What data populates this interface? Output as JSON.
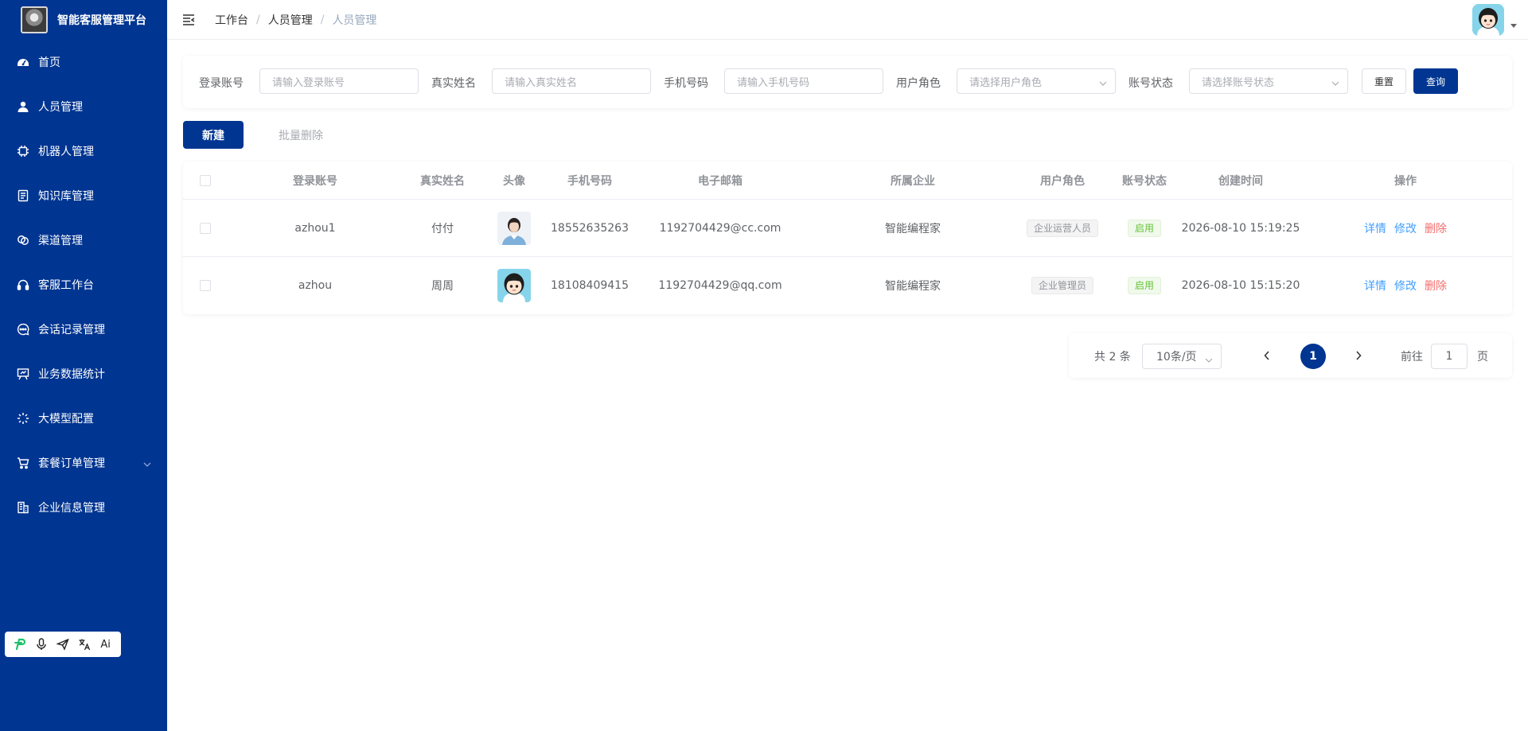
{
  "app": {
    "title": "智能客服管理平台"
  },
  "sidebar": {
    "items": [
      {
        "label": "首页",
        "icon": "dashboard-icon"
      },
      {
        "label": "人员管理",
        "icon": "user-icon"
      },
      {
        "label": "机器人管理",
        "icon": "chip-icon"
      },
      {
        "label": "知识库管理",
        "icon": "document-icon"
      },
      {
        "label": "渠道管理",
        "icon": "link-icon"
      },
      {
        "label": "客服工作台",
        "icon": "headset-icon"
      },
      {
        "label": "会话记录管理",
        "icon": "chat-icon"
      },
      {
        "label": "业务数据统计",
        "icon": "presentation-icon"
      },
      {
        "label": "大模型配置",
        "icon": "sparkle-icon"
      },
      {
        "label": "套餐订单管理",
        "icon": "cart-icon",
        "has_submenu": true
      },
      {
        "label": "企业信息管理",
        "icon": "building-icon"
      }
    ],
    "toolbar": {
      "ai_label": "Ai"
    }
  },
  "header": {
    "breadcrumb": [
      "工作台",
      "人员管理",
      "人员管理"
    ]
  },
  "search": {
    "account_label": "登录账号",
    "account_placeholder": "请输入登录账号",
    "name_label": "真实姓名",
    "name_placeholder": "请输入真实姓名",
    "phone_label": "手机号码",
    "phone_placeholder": "请输入手机号码",
    "role_label": "用户角色",
    "role_placeholder": "请选择用户角色",
    "status_label": "账号状态",
    "status_placeholder": "请选择账号状态",
    "reset_label": "重置",
    "query_label": "查询"
  },
  "actions": {
    "new_label": "新建",
    "batch_delete_label": "批量删除"
  },
  "table": {
    "columns": [
      "登录账号",
      "真实姓名",
      "头像",
      "手机号码",
      "电子邮箱",
      "所属企业",
      "用户角色",
      "账号状态",
      "创建时间",
      "操作"
    ],
    "rows": [
      {
        "account": "azhou1",
        "name": "付付",
        "phone": "18552635263",
        "email": "1192704429@cc.com",
        "company": "智能编程家",
        "role": "企业运营人员",
        "status": "启用",
        "created": "2026-08-10 15:19:25"
      },
      {
        "account": "azhou",
        "name": "周周",
        "phone": "18108409415",
        "email": "1192704429@qq.com",
        "company": "智能编程家",
        "role": "企业管理员",
        "status": "启用",
        "created": "2026-08-10 15:15:20"
      }
    ],
    "ops": {
      "detail": "详情",
      "edit": "修改",
      "delete": "删除"
    }
  },
  "pagination": {
    "total": "共 2 条",
    "page_size": "10条/页",
    "current_page": "1",
    "goto_label": "前往",
    "goto_value": "1",
    "page_unit": "页"
  },
  "colors": {
    "sidebar_bg": "#003591",
    "primary": "#003591",
    "link_blue": "#409eff",
    "danger": "#f56c6c",
    "success": "#67c23a"
  }
}
